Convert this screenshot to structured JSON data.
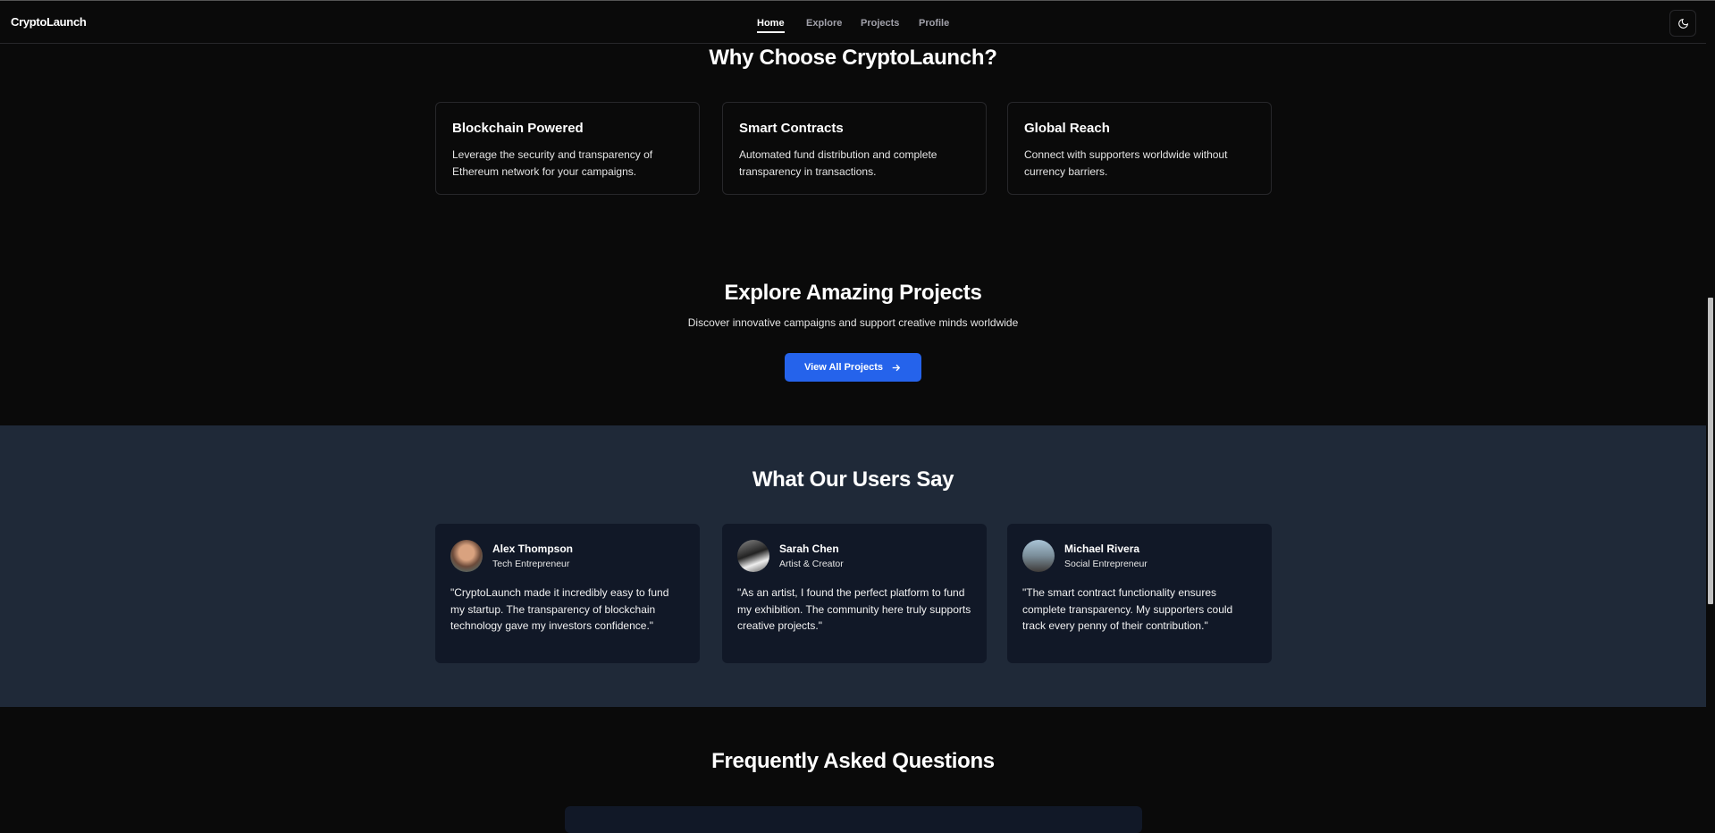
{
  "header": {
    "logo": "CryptoLaunch",
    "nav": [
      {
        "label": "Home",
        "active": true
      },
      {
        "label": "Explore"
      },
      {
        "label": "Projects"
      },
      {
        "label": "Profile"
      }
    ],
    "theme_icon": "moon-icon"
  },
  "why": {
    "title": "Why Choose CryptoLaunch?",
    "features": [
      {
        "title": "Blockchain Powered",
        "line1": "Leverage the security and transparency of",
        "line2": "Ethereum network for your campaigns."
      },
      {
        "title": "Smart Contracts",
        "line1": "Automated fund distribution and complete",
        "line2": "transparency in transactions."
      },
      {
        "title": "Global Reach",
        "line1": "Connect with supporters worldwide without",
        "line2": "currency barriers."
      }
    ]
  },
  "explore": {
    "title": "Explore Amazing Projects",
    "subtitle": "Discover innovative campaigns and support creative minds worldwide",
    "button": "View All Projects",
    "button_icon": "arrow-right-icon",
    "accent": "#2563eb"
  },
  "testimonials": {
    "title": "What Our Users Say",
    "items": [
      {
        "name": "Alex Thompson",
        "role": "Tech Entrepreneur",
        "quote": "\"CryptoLaunch made it incredibly easy to fund my startup. The transparency of blockchain technology gave my investors confidence.\""
      },
      {
        "name": "Sarah Chen",
        "role": "Artist & Creator",
        "quote": "\"As an artist, I found the perfect platform to fund my exhibition. The community here truly supports creative projects.\""
      },
      {
        "name": "Michael Rivera",
        "role": "Social Entrepreneur",
        "quote": "\"The smart contract functionality ensures complete transparency. My supporters could track every penny of their contribution.\""
      }
    ]
  },
  "faq": {
    "title": "Frequently Asked Questions"
  }
}
